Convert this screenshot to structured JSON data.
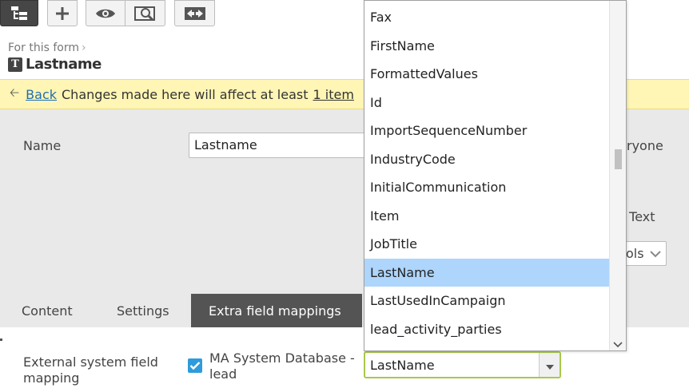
{
  "toolbar": {
    "icons": [
      "tree-view-icon",
      "add-icon",
      "preview-icon",
      "search-preview-icon",
      "compare-icon"
    ]
  },
  "breadcrumb": {
    "parent": "For this form",
    "separator": "›"
  },
  "page": {
    "title": "Lastname",
    "type_badge": "T"
  },
  "notice": {
    "back_label": "Back",
    "message": "Changes made here will affect at least",
    "link": "1 item"
  },
  "settings": {
    "name_label": "Name",
    "name_value": "Lastname",
    "partial_right_1": "ryone",
    "partial_right_2": ". Text",
    "partial_select": "ols"
  },
  "tabs": [
    {
      "label": "Content",
      "active": false
    },
    {
      "label": "Settings",
      "active": false
    },
    {
      "label": "Extra field mappings",
      "active": true
    }
  ],
  "mapping": {
    "label": "External system field mapping",
    "checkbox_checked": true,
    "checkbox_label": "MA System Database - lead",
    "combo_value": "LastName"
  },
  "dropdown": {
    "options": [
      "Fax",
      "FirstName",
      "FormattedValues",
      "Id",
      "ImportSequenceNumber",
      "IndustryCode",
      "InitialCommunication",
      "Item",
      "JobTitle",
      "LastName",
      "LastUsedInCampaign",
      "lead_activity_parties"
    ],
    "selected": "LastName"
  },
  "colors": {
    "notice_bg": "#fff5b4",
    "active_tab": "#545454",
    "selected_option": "#aed5fb",
    "checkbox": "#2e9bdc",
    "combo_border": "#a8c84a",
    "link": "#1f6fb5"
  }
}
